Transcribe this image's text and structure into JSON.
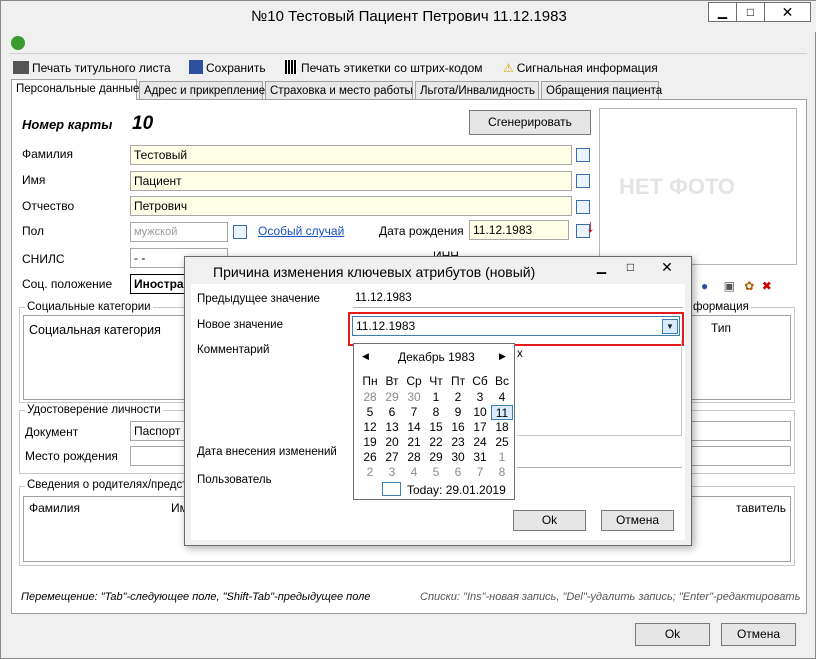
{
  "window": {
    "title": "№10 Тестовый Пациент Петрович 11.12.1983"
  },
  "toolbar": {
    "print_title": "Печать титульного листа",
    "save": "Сохранить",
    "print_barcode": "Печать этикетки со штрих-кодом",
    "signal_info": "Сигнальная информация"
  },
  "tabs": [
    "Персональные данные",
    "Адрес и прикрепление",
    "Страховка и место работы",
    "Льгота/Инвалидность",
    "Обращения пациента"
  ],
  "form": {
    "card_label": "Номер карты",
    "card_value": "10",
    "generate": "Сгенерировать",
    "surname_label": "Фамилия",
    "surname": "Тестовый",
    "name_label": "Имя",
    "name": "Пациент",
    "patronymic_label": "Отчество",
    "patronymic": "Петрович",
    "sex_label": "Пол",
    "sex": "мужской",
    "special_case": "Особый случай",
    "birth_label": "Дата рождения",
    "birth": "11.12.1983",
    "snils_label": "СНИЛС",
    "snils": "-  -",
    "inn_label": "ИНН",
    "social_label": "Соц. положение",
    "social_value": "Иностран",
    "no_photo": "НЕТ ФОТО",
    "social_categories_group": "Социальные категории",
    "social_category_col": "Социальная категория",
    "info_group_tail": "формация",
    "type_col": "Тип",
    "identity_group": "Удостоверение личности",
    "document_label": "Документ",
    "document_value": "Паспорт г",
    "birthplace_label": "Место рождения",
    "parents_group": "Сведения о родителях/представ",
    "surname_col": "Фамилия",
    "im_col": "Им",
    "rep_col": "тавитель"
  },
  "hints": {
    "left": "Перемещение: \"Tab\"-следующее поле, \"Shift-Tab\"-предыдущее поле",
    "right": "Списки: \"Ins\"-новая запись, \"Del\"-удалить запись; \"Enter\"-редактировать"
  },
  "bottom": {
    "ok": "Ok",
    "cancel": "Отмена"
  },
  "dialog": {
    "title": "Причина изменения ключевых атрибутов (новый)",
    "prev_label": "Предыдущее значение",
    "prev_value": "11.12.1983",
    "new_label": "Новое значение",
    "new_value": "11.12.1983",
    "comment_label": "Комментарий",
    "comment_tail": "х",
    "date_label": "Дата внесения изменений",
    "user_label": "Пользователь",
    "ok": "Ok",
    "cancel": "Отмена"
  },
  "calendar": {
    "month": "Декабрь 1983",
    "prev": "◀",
    "next": "▶",
    "weekdays": [
      "Пн",
      "Вт",
      "Ср",
      "Чт",
      "Пт",
      "Сб",
      "Вс"
    ],
    "weeks": [
      [
        "28",
        "29",
        "30",
        "1",
        "2",
        "3",
        "4"
      ],
      [
        "5",
        "6",
        "7",
        "8",
        "9",
        "10",
        "11"
      ],
      [
        "12",
        "13",
        "14",
        "15",
        "16",
        "17",
        "18"
      ],
      [
        "19",
        "20",
        "21",
        "22",
        "23",
        "24",
        "25"
      ],
      [
        "26",
        "27",
        "28",
        "29",
        "30",
        "31",
        "1"
      ],
      [
        "2",
        "3",
        "4",
        "5",
        "6",
        "7",
        "8"
      ]
    ],
    "today": "Today: 29.01.2019"
  }
}
